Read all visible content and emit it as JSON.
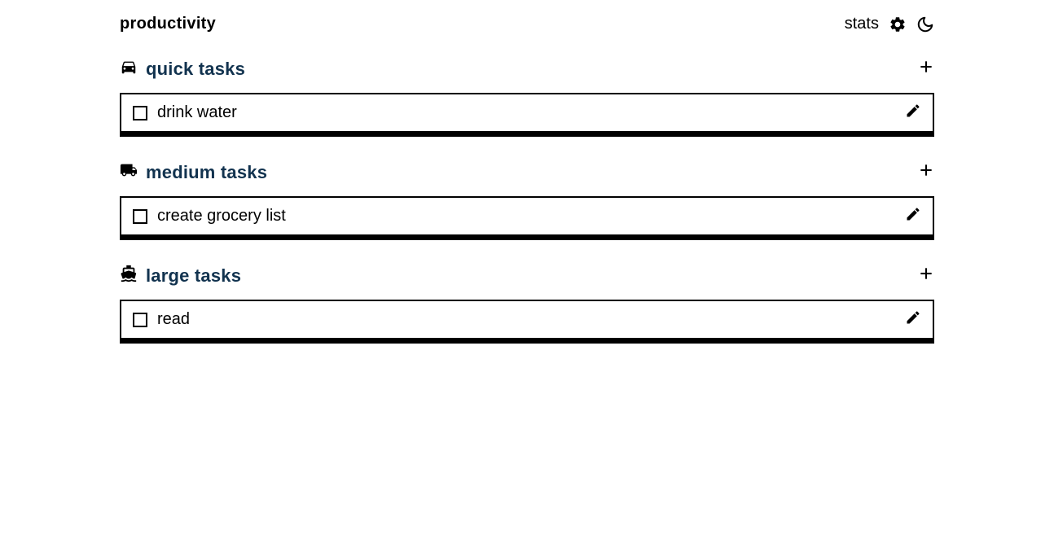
{
  "header": {
    "title": "productivity",
    "stats_label": "stats"
  },
  "sections": [
    {
      "id": "quick",
      "title": "quick tasks",
      "icon": "car-icon",
      "tasks": [
        {
          "text": "drink water",
          "done": false
        }
      ]
    },
    {
      "id": "medium",
      "title": "medium tasks",
      "icon": "truck-icon",
      "tasks": [
        {
          "text": "create grocery list",
          "done": false
        }
      ]
    },
    {
      "id": "large",
      "title": "large tasks",
      "icon": "ship-icon",
      "tasks": [
        {
          "text": "read",
          "done": false
        }
      ]
    }
  ]
}
